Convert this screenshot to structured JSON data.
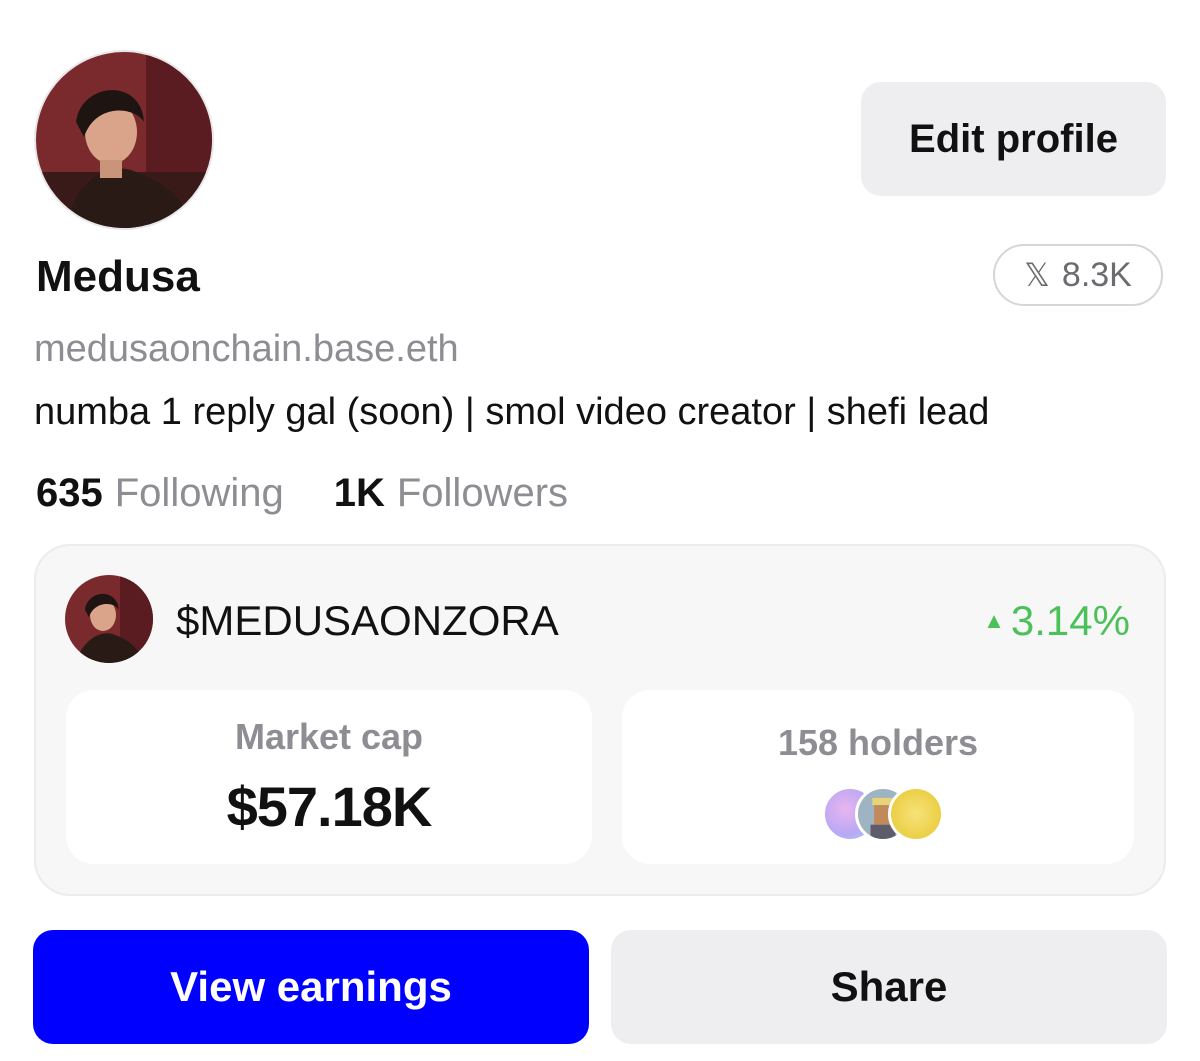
{
  "profile": {
    "name": "Medusa",
    "handle": "medusaonchain.base.eth",
    "bio": "numba 1 reply gal (soon) | smol video creator | shefi lead",
    "edit_label": "Edit profile",
    "x_followers": "8.3K",
    "following_count": "635",
    "following_label": "Following",
    "followers_count": "1K",
    "followers_label": "Followers"
  },
  "coin": {
    "ticker": "$MEDUSAONZORA",
    "change": "3.14%",
    "change_color": "#4cc15a",
    "market_cap_label": "Market cap",
    "market_cap_value": "$57.18K",
    "holders_label": "158 holders"
  },
  "actions": {
    "view_earnings_label": "View earnings",
    "view_earnings_color": "#0000ff",
    "share_label": "Share"
  },
  "icons": {
    "x_logo": "x-logo-icon",
    "change_up": "triangle-up-icon"
  }
}
